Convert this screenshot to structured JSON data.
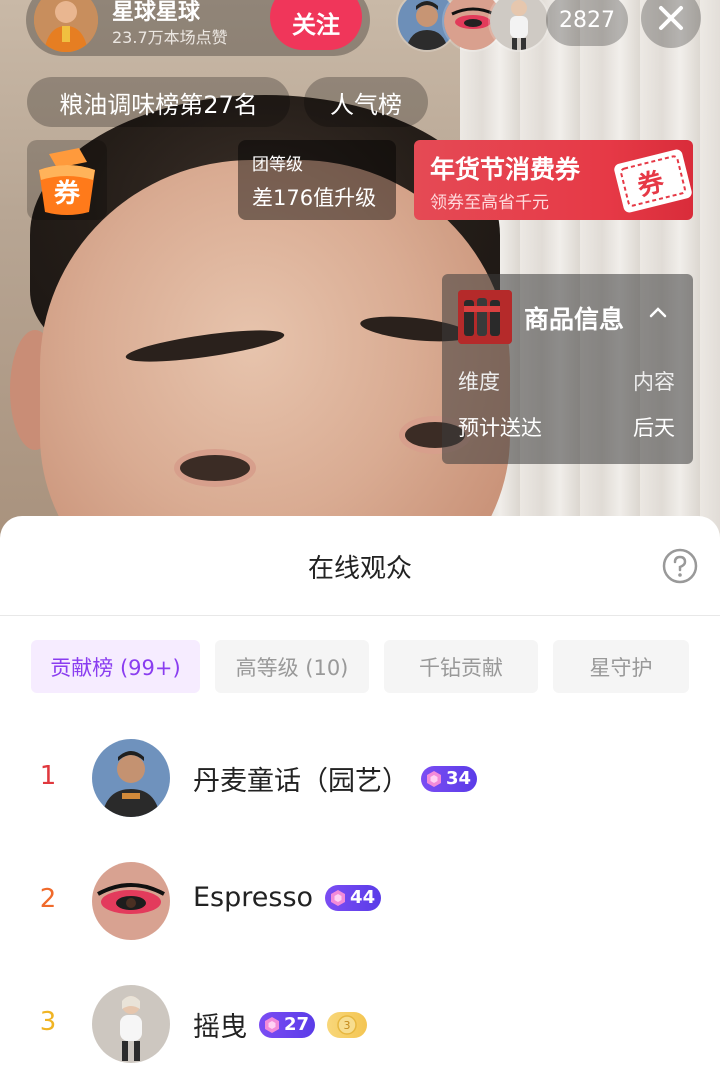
{
  "anchor": {
    "name": "星球星球",
    "likes": "23.7万本场点赞",
    "follow_label": "关注"
  },
  "viewer_count": "2827",
  "rank_pills": [
    "粮油调味榜第27名",
    "人气榜"
  ],
  "level_box": {
    "label": "团等级",
    "value": "差176值升级"
  },
  "coupon": {
    "icon_text": "券"
  },
  "banner": {
    "title": "年货节消费券",
    "subtitle": "领券至高省千元",
    "stamp": "券"
  },
  "product_card": {
    "title": "商品信息",
    "rows": [
      {
        "key": "维度",
        "value": "内容"
      },
      {
        "key": "预计送达",
        "value": "后天"
      }
    ]
  },
  "sheet": {
    "title": "在线观众",
    "tabs": [
      {
        "label": "贡献榜 (99+)",
        "active": true
      },
      {
        "label": "高等级 (10)",
        "active": false
      },
      {
        "label": "千钻贡献",
        "active": false
      },
      {
        "label": "星守护",
        "active": false
      }
    ],
    "viewers": [
      {
        "rank": "1",
        "name": "丹麦童话（园艺）",
        "level": "34"
      },
      {
        "rank": "2",
        "name": "Espresso",
        "level": "44"
      },
      {
        "rank": "3",
        "name": "摇曳",
        "level": "27",
        "fan_badge": "3"
      }
    ]
  },
  "colors": {
    "accent_purple": "#8a3df0",
    "follow_red": "#f0365a",
    "rank1": "#e0383e",
    "rank2": "#f06a2b",
    "rank3": "#f0b423"
  }
}
